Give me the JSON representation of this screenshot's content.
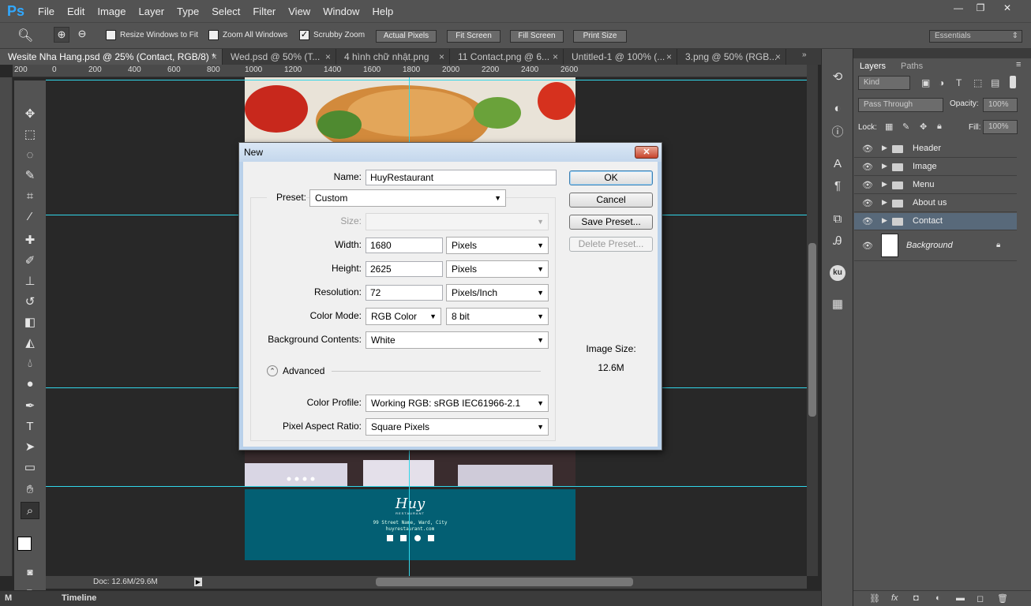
{
  "app": {
    "logo": "Ps"
  },
  "menubar": {
    "items": [
      "File",
      "Edit",
      "Image",
      "Layer",
      "Type",
      "Select",
      "Filter",
      "View",
      "Window",
      "Help"
    ]
  },
  "window_controls": {
    "minimize": "—",
    "restore": "❐",
    "close": "✕"
  },
  "options": {
    "resize_windows": "Resize Windows to Fit",
    "zoom_all": "Zoom All Windows",
    "scrubby": "Scrubby Zoom",
    "scrubby_checked": true,
    "actual_pixels": "Actual Pixels",
    "fit_screen": "Fit Screen",
    "fill_screen": "Fill Screen",
    "print_size": "Print Size",
    "workspace": "Essentials"
  },
  "tabs": [
    {
      "label": "Wesite Nha Hang.psd @ 25% (Contact, RGB/8) *",
      "active": true
    },
    {
      "label": "Wed.psd @ 50% (T..."
    },
    {
      "label": "4 hình chữ nhật.png"
    },
    {
      "label": "11 Contact.png @ 6..."
    },
    {
      "label": "Untitled-1 @ 100% (..."
    },
    {
      "label": "3.png @ 50% (RGB..."
    }
  ],
  "ruler_h": [
    "200",
    "0",
    "200",
    "400",
    "600",
    "800",
    "1000",
    "1200",
    "1400",
    "1600",
    "1800",
    "2000",
    "2200",
    "2400",
    "2600"
  ],
  "status": {
    "doc": "Doc: 12.6M/29.6M",
    "timeline": "Timeline",
    "mini_label": "M"
  },
  "canvas": {
    "footer_logo": "Huy",
    "footer_sub": "RESTAURANT",
    "footer_address": "99 Street Name, Ward, City",
    "footer_url": "huyrestaurant.com"
  },
  "layers_panel": {
    "tab_layers": "Layers",
    "tab_paths": "Paths",
    "kind": "Kind",
    "blend": "Pass Through",
    "opacity_label": "Opacity:",
    "opacity": "100%",
    "lock_label": "Lock:",
    "fill_label": "Fill:",
    "fill": "100%",
    "layers": [
      {
        "name": "Header",
        "type": "group"
      },
      {
        "name": "Image",
        "type": "group"
      },
      {
        "name": "Menu",
        "type": "group"
      },
      {
        "name": "About us",
        "type": "group"
      },
      {
        "name": "Contact",
        "type": "group",
        "selected": true
      },
      {
        "name": "Background",
        "type": "background"
      }
    ]
  },
  "dialog": {
    "title": "New",
    "name_label": "Name:",
    "name": "HuyRestaurant",
    "preset_label": "Preset:",
    "preset": "Custom",
    "size_label": "Size:",
    "size": "",
    "width_label": "Width:",
    "width": "1680",
    "width_unit": "Pixels",
    "height_label": "Height:",
    "height": "2625",
    "height_unit": "Pixels",
    "resolution_label": "Resolution:",
    "resolution": "72",
    "resolution_unit": "Pixels/Inch",
    "color_mode_label": "Color Mode:",
    "color_mode": "RGB Color",
    "bit_depth": "8 bit",
    "bg_contents_label": "Background Contents:",
    "bg_contents": "White",
    "advanced_label": "Advanced",
    "color_profile_label": "Color Profile:",
    "color_profile": "Working RGB:  sRGB IEC61966-2.1",
    "pixel_aspect_label": "Pixel Aspect Ratio:",
    "pixel_aspect": "Square Pixels",
    "ok": "OK",
    "cancel": "Cancel",
    "save_preset": "Save Preset...",
    "delete_preset": "Delete Preset...",
    "image_size_label": "Image Size:",
    "image_size": "12.6M"
  },
  "colors": {
    "guide": "#31d6e9",
    "footer_bg": "#035f73",
    "selected_layer": "#58697a"
  }
}
